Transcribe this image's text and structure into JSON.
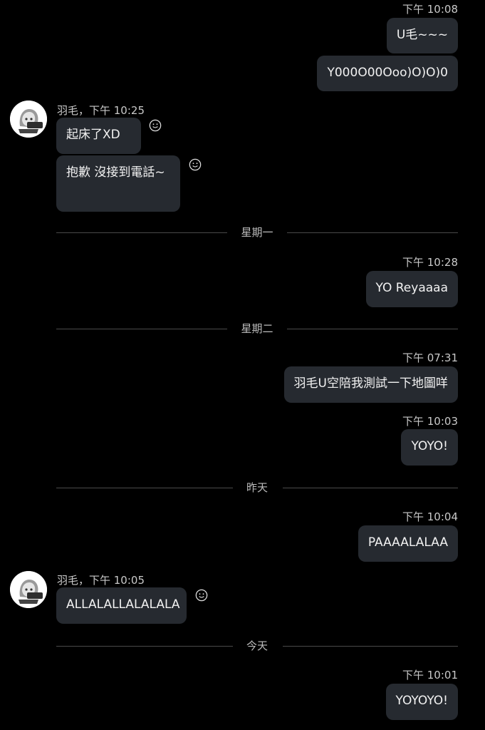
{
  "colors": {
    "background": "#000000",
    "bubble": "#262a30",
    "text": "#f2f2f2",
    "meta": "#c9c9c9"
  },
  "messages": [
    {
      "time": "下午 10:08",
      "texts": [
        "U毛~~~",
        "Y000O00Ooo)O)O)0"
      ]
    },
    {
      "sender": "羽毛，下午 10:25",
      "texts": [
        "起床了XD",
        "抱歉 沒接到電話~"
      ]
    },
    {
      "divider": "星期一"
    },
    {
      "time": "下午 10:28",
      "texts": [
        "YO Reyaaaa"
      ]
    },
    {
      "divider": "星期二"
    },
    {
      "time": "下午 07:31",
      "texts": [
        "羽毛U空陪我測試一下地圖咩"
      ]
    },
    {
      "time": "下午 10:03",
      "texts": [
        "YOYO!"
      ]
    },
    {
      "divider": "昨天"
    },
    {
      "time": "下午 10:04",
      "texts": [
        "PAAAALALAA"
      ]
    },
    {
      "sender": "羽毛，下午 10:05",
      "texts": [
        "ALLALALLALALALA"
      ]
    },
    {
      "divider": "今天"
    },
    {
      "time": "下午 10:01",
      "texts": [
        "YOYOYO!"
      ]
    }
  ],
  "icons": {
    "reaction": "smiley-icon",
    "avatar": "avatar-illustration"
  }
}
